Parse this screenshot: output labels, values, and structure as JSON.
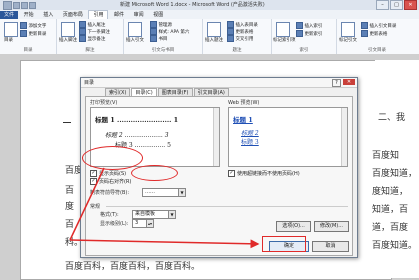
{
  "window": {
    "title": "新建 Microsoft Word 1.docx - Microsoft Word (产品激活失败)",
    "minimize": "–",
    "maximize": "□",
    "close": "✕"
  },
  "tabs": [
    "文件",
    "开始",
    "插入",
    "页面布局",
    "引用",
    "邮件",
    "审阅",
    "视图"
  ],
  "ribbon": {
    "groups": [
      {
        "label": "目录",
        "big": "目录",
        "items": [
          "添加文字",
          "更新目录"
        ]
      },
      {
        "label": "脚注",
        "big": "插入脚注",
        "items": [
          "插入尾注",
          "下一条脚注",
          "显示备注"
        ]
      },
      {
        "label": "引文与书目",
        "big": "插入引文",
        "items": [
          "管理源",
          "样式: APA 第六",
          "书目"
        ]
      },
      {
        "label": "题注",
        "big": "插入题注",
        "items": [
          "插入表目录",
          "更新表格",
          "交叉引用"
        ]
      },
      {
        "label": "索引",
        "big": "标记索引项",
        "items": [
          "插入索引",
          "更新索引"
        ]
      },
      {
        "label": "引文目录",
        "big": "标记引文",
        "items": [
          "插入引文目录",
          "更新表格"
        ]
      }
    ]
  },
  "document": {
    "heading_right": "二、我",
    "left_lines": [
      "百度",
      "百",
      "度",
      "百",
      "百",
      "科。",
      "百度百科，百度百科，百度百科。"
    ],
    "right_lines": [
      "百度知",
      "百度知道，",
      "度知道，",
      "知道，百",
      "道，百度",
      "百度知道。"
    ]
  },
  "dialog": {
    "title": "目录",
    "help": "?",
    "close": "✕",
    "tabs": [
      "索引(X)",
      "目录(C)",
      "图表目录(F)",
      "引文目录(A)"
    ],
    "print_preview_label": "打印预览(V)",
    "web_preview_label": "Web 预览(W)",
    "toc_preview": [
      {
        "text": "标题 1",
        "page": "1"
      },
      {
        "text": "标题 2",
        "page": "3"
      },
      {
        "text": "标题 3",
        "page": "5"
      }
    ],
    "web_preview": [
      "标题 1",
      "标题 2",
      "标题 3"
    ],
    "show_page_numbers": "显示页码(S)",
    "right_align_page_numbers": "页码右对齐(R)",
    "use_hyperlinks": "使用超链接而不使用页码(H)",
    "tab_leader_label": "制表符前导符(B):",
    "tab_leader_value": "……",
    "general_label": "常规",
    "formats_label": "格式(T):",
    "formats_value": "来自模板",
    "levels_label": "显示级别(L):",
    "levels_value": "3",
    "options_button": "选项(O)...",
    "modify_button": "修改(M)...",
    "ok_button": "确定",
    "cancel_button": "取消"
  },
  "colors": {
    "accent": "#2b579a",
    "annotation": "#e02a2a",
    "link": "#1f4fb5"
  }
}
